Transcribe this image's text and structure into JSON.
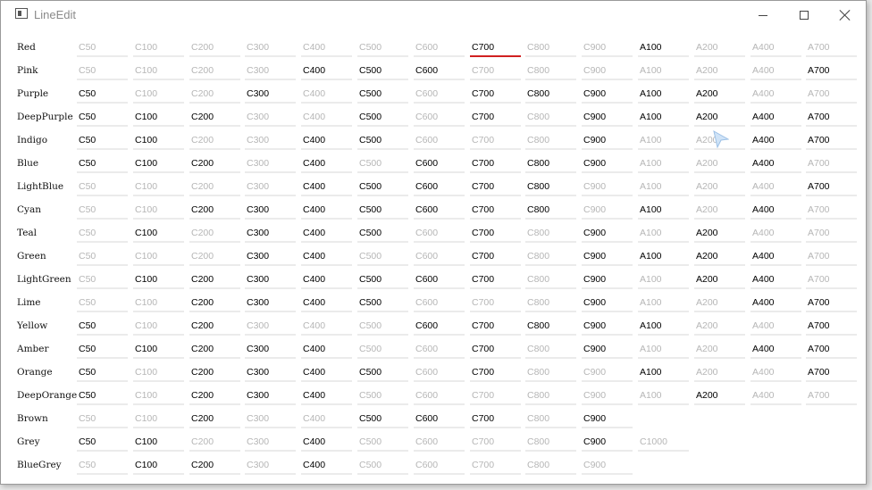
{
  "window": {
    "title": "LineEdit",
    "controls": {
      "minimize": "minimize",
      "maximize": "maximize",
      "close": "close"
    }
  },
  "colors": {
    "accent_underline": "#d02020",
    "field_underline": "#ebebeb",
    "text_active": "#000000",
    "text_placeholder": "#b6b6b6"
  },
  "focused_field": {
    "row": "Red",
    "value": "C700"
  },
  "rows": [
    {
      "name": "Red",
      "fields": [
        {
          "t": "C50",
          "a": 0
        },
        {
          "t": "C100",
          "a": 0
        },
        {
          "t": "C200",
          "a": 0
        },
        {
          "t": "C300",
          "a": 0
        },
        {
          "t": "C400",
          "a": 0
        },
        {
          "t": "C500",
          "a": 0
        },
        {
          "t": "C600",
          "a": 0
        },
        {
          "t": "C700",
          "a": 1
        },
        {
          "t": "C800",
          "a": 0
        },
        {
          "t": "C900",
          "a": 0
        },
        {
          "t": "A100",
          "a": 1
        },
        {
          "t": "A200",
          "a": 0
        },
        {
          "t": "A400",
          "a": 0
        },
        {
          "t": "A700",
          "a": 0
        }
      ]
    },
    {
      "name": "Pink",
      "fields": [
        {
          "t": "C50",
          "a": 0
        },
        {
          "t": "C100",
          "a": 0
        },
        {
          "t": "C200",
          "a": 0
        },
        {
          "t": "C300",
          "a": 0
        },
        {
          "t": "C400",
          "a": 1
        },
        {
          "t": "C500",
          "a": 1
        },
        {
          "t": "C600",
          "a": 1
        },
        {
          "t": "C700",
          "a": 0
        },
        {
          "t": "C800",
          "a": 0
        },
        {
          "t": "C900",
          "a": 0
        },
        {
          "t": "A100",
          "a": 0
        },
        {
          "t": "A200",
          "a": 0
        },
        {
          "t": "A400",
          "a": 0
        },
        {
          "t": "A700",
          "a": 1
        }
      ]
    },
    {
      "name": "Purple",
      "fields": [
        {
          "t": "C50",
          "a": 1
        },
        {
          "t": "C100",
          "a": 0
        },
        {
          "t": "C200",
          "a": 0
        },
        {
          "t": "C300",
          "a": 1
        },
        {
          "t": "C400",
          "a": 0
        },
        {
          "t": "C500",
          "a": 1
        },
        {
          "t": "C600",
          "a": 0
        },
        {
          "t": "C700",
          "a": 1
        },
        {
          "t": "C800",
          "a": 1
        },
        {
          "t": "C900",
          "a": 1
        },
        {
          "t": "A100",
          "a": 1
        },
        {
          "t": "A200",
          "a": 1
        },
        {
          "t": "A400",
          "a": 0
        },
        {
          "t": "A700",
          "a": 0
        }
      ]
    },
    {
      "name": "DeepPurple",
      "fields": [
        {
          "t": "C50",
          "a": 1
        },
        {
          "t": "C100",
          "a": 1
        },
        {
          "t": "C200",
          "a": 1
        },
        {
          "t": "C300",
          "a": 0
        },
        {
          "t": "C400",
          "a": 0
        },
        {
          "t": "C500",
          "a": 1
        },
        {
          "t": "C600",
          "a": 0
        },
        {
          "t": "C700",
          "a": 1
        },
        {
          "t": "C800",
          "a": 0
        },
        {
          "t": "C900",
          "a": 1
        },
        {
          "t": "A100",
          "a": 1
        },
        {
          "t": "A200",
          "a": 1
        },
        {
          "t": "A400",
          "a": 1
        },
        {
          "t": "A700",
          "a": 1
        }
      ]
    },
    {
      "name": "Indigo",
      "fields": [
        {
          "t": "C50",
          "a": 1
        },
        {
          "t": "C100",
          "a": 1
        },
        {
          "t": "C200",
          "a": 0
        },
        {
          "t": "C300",
          "a": 0
        },
        {
          "t": "C400",
          "a": 1
        },
        {
          "t": "C500",
          "a": 1
        },
        {
          "t": "C600",
          "a": 0
        },
        {
          "t": "C700",
          "a": 0
        },
        {
          "t": "C800",
          "a": 0
        },
        {
          "t": "C900",
          "a": 1
        },
        {
          "t": "A100",
          "a": 0
        },
        {
          "t": "A200",
          "a": 0
        },
        {
          "t": "A400",
          "a": 1
        },
        {
          "t": "A700",
          "a": 1
        }
      ]
    },
    {
      "name": "Blue",
      "fields": [
        {
          "t": "C50",
          "a": 1
        },
        {
          "t": "C100",
          "a": 1
        },
        {
          "t": "C200",
          "a": 1
        },
        {
          "t": "C300",
          "a": 0
        },
        {
          "t": "C400",
          "a": 1
        },
        {
          "t": "C500",
          "a": 0
        },
        {
          "t": "C600",
          "a": 1
        },
        {
          "t": "C700",
          "a": 1
        },
        {
          "t": "C800",
          "a": 1
        },
        {
          "t": "C900",
          "a": 1
        },
        {
          "t": "A100",
          "a": 0
        },
        {
          "t": "A200",
          "a": 0
        },
        {
          "t": "A400",
          "a": 1
        },
        {
          "t": "A700",
          "a": 0
        }
      ]
    },
    {
      "name": "LightBlue",
      "fields": [
        {
          "t": "C50",
          "a": 0
        },
        {
          "t": "C100",
          "a": 0
        },
        {
          "t": "C200",
          "a": 0
        },
        {
          "t": "C300",
          "a": 0
        },
        {
          "t": "C400",
          "a": 1
        },
        {
          "t": "C500",
          "a": 1
        },
        {
          "t": "C600",
          "a": 1
        },
        {
          "t": "C700",
          "a": 1
        },
        {
          "t": "C800",
          "a": 1
        },
        {
          "t": "C900",
          "a": 0
        },
        {
          "t": "A100",
          "a": 0
        },
        {
          "t": "A200",
          "a": 0
        },
        {
          "t": "A400",
          "a": 0
        },
        {
          "t": "A700",
          "a": 1
        }
      ]
    },
    {
      "name": "Cyan",
      "fields": [
        {
          "t": "C50",
          "a": 0
        },
        {
          "t": "C100",
          "a": 0
        },
        {
          "t": "C200",
          "a": 1
        },
        {
          "t": "C300",
          "a": 1
        },
        {
          "t": "C400",
          "a": 1
        },
        {
          "t": "C500",
          "a": 1
        },
        {
          "t": "C600",
          "a": 1
        },
        {
          "t": "C700",
          "a": 1
        },
        {
          "t": "C800",
          "a": 1
        },
        {
          "t": "C900",
          "a": 0
        },
        {
          "t": "A100",
          "a": 1
        },
        {
          "t": "A200",
          "a": 0
        },
        {
          "t": "A400",
          "a": 1
        },
        {
          "t": "A700",
          "a": 0
        }
      ]
    },
    {
      "name": "Teal",
      "fields": [
        {
          "t": "C50",
          "a": 0
        },
        {
          "t": "C100",
          "a": 1
        },
        {
          "t": "C200",
          "a": 0
        },
        {
          "t": "C300",
          "a": 1
        },
        {
          "t": "C400",
          "a": 1
        },
        {
          "t": "C500",
          "a": 1
        },
        {
          "t": "C600",
          "a": 0
        },
        {
          "t": "C700",
          "a": 1
        },
        {
          "t": "C800",
          "a": 0
        },
        {
          "t": "C900",
          "a": 1
        },
        {
          "t": "A100",
          "a": 0
        },
        {
          "t": "A200",
          "a": 1
        },
        {
          "t": "A400",
          "a": 0
        },
        {
          "t": "A700",
          "a": 0
        }
      ]
    },
    {
      "name": "Green",
      "fields": [
        {
          "t": "C50",
          "a": 0
        },
        {
          "t": "C100",
          "a": 0
        },
        {
          "t": "C200",
          "a": 0
        },
        {
          "t": "C300",
          "a": 1
        },
        {
          "t": "C400",
          "a": 1
        },
        {
          "t": "C500",
          "a": 0
        },
        {
          "t": "C600",
          "a": 0
        },
        {
          "t": "C700",
          "a": 1
        },
        {
          "t": "C800",
          "a": 0
        },
        {
          "t": "C900",
          "a": 1
        },
        {
          "t": "A100",
          "a": 1
        },
        {
          "t": "A200",
          "a": 1
        },
        {
          "t": "A400",
          "a": 1
        },
        {
          "t": "A700",
          "a": 0
        }
      ]
    },
    {
      "name": "LightGreen",
      "fields": [
        {
          "t": "C50",
          "a": 0
        },
        {
          "t": "C100",
          "a": 1
        },
        {
          "t": "C200",
          "a": 1
        },
        {
          "t": "C300",
          "a": 1
        },
        {
          "t": "C400",
          "a": 1
        },
        {
          "t": "C500",
          "a": 1
        },
        {
          "t": "C600",
          "a": 1
        },
        {
          "t": "C700",
          "a": 1
        },
        {
          "t": "C800",
          "a": 0
        },
        {
          "t": "C900",
          "a": 1
        },
        {
          "t": "A100",
          "a": 0
        },
        {
          "t": "A200",
          "a": 1
        },
        {
          "t": "A400",
          "a": 1
        },
        {
          "t": "A700",
          "a": 0
        }
      ]
    },
    {
      "name": "Lime",
      "fields": [
        {
          "t": "C50",
          "a": 0
        },
        {
          "t": "C100",
          "a": 0
        },
        {
          "t": "C200",
          "a": 1
        },
        {
          "t": "C300",
          "a": 1
        },
        {
          "t": "C400",
          "a": 1
        },
        {
          "t": "C500",
          "a": 1
        },
        {
          "t": "C600",
          "a": 0
        },
        {
          "t": "C700",
          "a": 0
        },
        {
          "t": "C800",
          "a": 0
        },
        {
          "t": "C900",
          "a": 1
        },
        {
          "t": "A100",
          "a": 0
        },
        {
          "t": "A200",
          "a": 0
        },
        {
          "t": "A400",
          "a": 1
        },
        {
          "t": "A700",
          "a": 1
        }
      ]
    },
    {
      "name": "Yellow",
      "fields": [
        {
          "t": "C50",
          "a": 1
        },
        {
          "t": "C100",
          "a": 0
        },
        {
          "t": "C200",
          "a": 1
        },
        {
          "t": "C300",
          "a": 0
        },
        {
          "t": "C400",
          "a": 0
        },
        {
          "t": "C500",
          "a": 0
        },
        {
          "t": "C600",
          "a": 1
        },
        {
          "t": "C700",
          "a": 1
        },
        {
          "t": "C800",
          "a": 1
        },
        {
          "t": "C900",
          "a": 1
        },
        {
          "t": "A100",
          "a": 1
        },
        {
          "t": "A200",
          "a": 0
        },
        {
          "t": "A400",
          "a": 0
        },
        {
          "t": "A700",
          "a": 1
        }
      ]
    },
    {
      "name": "Amber",
      "fields": [
        {
          "t": "C50",
          "a": 1
        },
        {
          "t": "C100",
          "a": 1
        },
        {
          "t": "C200",
          "a": 1
        },
        {
          "t": "C300",
          "a": 1
        },
        {
          "t": "C400",
          "a": 1
        },
        {
          "t": "C500",
          "a": 0
        },
        {
          "t": "C600",
          "a": 0
        },
        {
          "t": "C700",
          "a": 1
        },
        {
          "t": "C800",
          "a": 0
        },
        {
          "t": "C900",
          "a": 1
        },
        {
          "t": "A100",
          "a": 0
        },
        {
          "t": "A200",
          "a": 0
        },
        {
          "t": "A400",
          "a": 1
        },
        {
          "t": "A700",
          "a": 1
        }
      ]
    },
    {
      "name": "Orange",
      "fields": [
        {
          "t": "C50",
          "a": 1
        },
        {
          "t": "C100",
          "a": 0
        },
        {
          "t": "C200",
          "a": 1
        },
        {
          "t": "C300",
          "a": 1
        },
        {
          "t": "C400",
          "a": 1
        },
        {
          "t": "C500",
          "a": 1
        },
        {
          "t": "C600",
          "a": 0
        },
        {
          "t": "C700",
          "a": 1
        },
        {
          "t": "C800",
          "a": 0
        },
        {
          "t": "C900",
          "a": 0
        },
        {
          "t": "A100",
          "a": 1
        },
        {
          "t": "A200",
          "a": 0
        },
        {
          "t": "A400",
          "a": 0
        },
        {
          "t": "A700",
          "a": 1
        }
      ]
    },
    {
      "name": "DeepOrange",
      "fields": [
        {
          "t": "C50",
          "a": 1
        },
        {
          "t": "C100",
          "a": 0
        },
        {
          "t": "C200",
          "a": 1
        },
        {
          "t": "C300",
          "a": 1
        },
        {
          "t": "C400",
          "a": 1
        },
        {
          "t": "C500",
          "a": 0
        },
        {
          "t": "C600",
          "a": 0
        },
        {
          "t": "C700",
          "a": 0
        },
        {
          "t": "C800",
          "a": 0
        },
        {
          "t": "C900",
          "a": 0
        },
        {
          "t": "A100",
          "a": 0
        },
        {
          "t": "A200",
          "a": 1
        },
        {
          "t": "A400",
          "a": 0
        },
        {
          "t": "A700",
          "a": 0
        }
      ]
    },
    {
      "name": "Brown",
      "fields": [
        {
          "t": "C50",
          "a": 0
        },
        {
          "t": "C100",
          "a": 0
        },
        {
          "t": "C200",
          "a": 1
        },
        {
          "t": "C300",
          "a": 0
        },
        {
          "t": "C400",
          "a": 0
        },
        {
          "t": "C500",
          "a": 1
        },
        {
          "t": "C600",
          "a": 1
        },
        {
          "t": "C700",
          "a": 1
        },
        {
          "t": "C800",
          "a": 0
        },
        {
          "t": "C900",
          "a": 1
        }
      ]
    },
    {
      "name": "Grey",
      "fields": [
        {
          "t": "C50",
          "a": 1
        },
        {
          "t": "C100",
          "a": 1
        },
        {
          "t": "C200",
          "a": 0
        },
        {
          "t": "C300",
          "a": 0
        },
        {
          "t": "C400",
          "a": 1
        },
        {
          "t": "C500",
          "a": 0
        },
        {
          "t": "C600",
          "a": 0
        },
        {
          "t": "C700",
          "a": 0
        },
        {
          "t": "C800",
          "a": 0
        },
        {
          "t": "C900",
          "a": 1
        },
        {
          "t": "C1000",
          "a": 0
        }
      ]
    },
    {
      "name": "BlueGrey",
      "fields": [
        {
          "t": "C50",
          "a": 0
        },
        {
          "t": "C100",
          "a": 1
        },
        {
          "t": "C200",
          "a": 1
        },
        {
          "t": "C300",
          "a": 0
        },
        {
          "t": "C400",
          "a": 1
        },
        {
          "t": "C500",
          "a": 0
        },
        {
          "t": "C600",
          "a": 0
        },
        {
          "t": "C700",
          "a": 0
        },
        {
          "t": "C800",
          "a": 0
        },
        {
          "t": "C900",
          "a": 0
        }
      ]
    }
  ]
}
